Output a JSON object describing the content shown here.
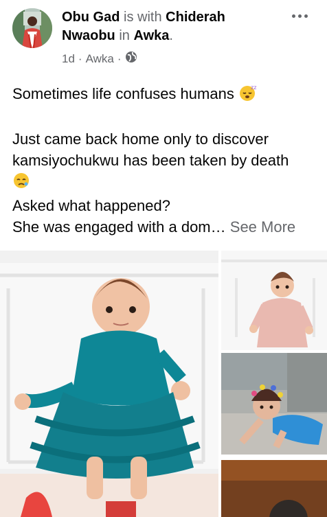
{
  "post": {
    "author": "Obu Gad",
    "with_text": "is with",
    "tagged": "Chiderah Nwaobu",
    "in_text": "in",
    "place": "Awka",
    "period": ".",
    "time": "1d",
    "location": "Awka",
    "separator": "·",
    "privacy_icon": "globe-icon",
    "more_icon": "more-options-icon"
  },
  "content": {
    "line1": "Sometimes life confuses humans",
    "line2": "Just came back home only to discover kamsiyochukwu has been taken by death",
    "line3": "Asked what happened?",
    "line4": "She was engaged with a dom…",
    "see_more": "See More"
  },
  "emojis": {
    "first": "sleepy-face",
    "second": "sad-face"
  },
  "colors": {
    "teal_dress": "#0f8c97",
    "pink_coat": "#e9b9b0",
    "blue_outfit": "#2f8fd6"
  },
  "photos": [
    "child-teal-dress-photo",
    "child-pink-coat-photo",
    "child-crawling-photo",
    "partial-photo"
  ]
}
